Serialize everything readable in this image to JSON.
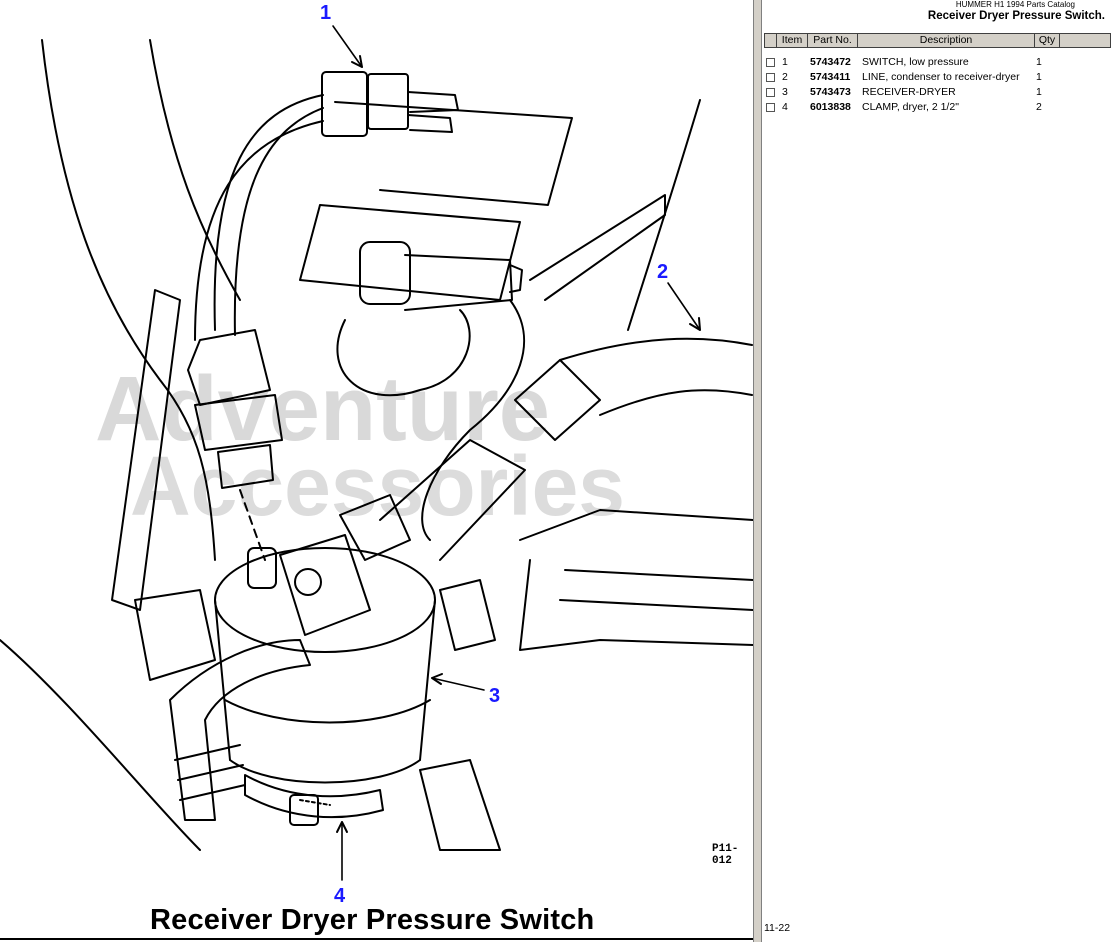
{
  "figure": {
    "callouts": [
      "1",
      "2",
      "3",
      "4"
    ],
    "code": "P11-012",
    "caption": "Receiver Dryer Pressure Switch",
    "watermark_line1": "Adventure",
    "watermark_line2": "Accessories"
  },
  "parts_panel": {
    "catalog_title": "HUMMER H1 1994 Parts Catalog",
    "heading": "Receiver Dryer Pressure Switch.",
    "columns": [
      "Item",
      "Part No.",
      "Description",
      "Qty"
    ],
    "rows": [
      {
        "item": "1",
        "part_no": "5743472",
        "description": "SWITCH, low pressure",
        "qty": "1"
      },
      {
        "item": "2",
        "part_no": "5743411",
        "description": "LINE, condenser to receiver-dryer",
        "qty": "1"
      },
      {
        "item": "3",
        "part_no": "5743473",
        "description": "RECEIVER-DRYER",
        "qty": "1"
      },
      {
        "item": "4",
        "part_no": "6013838",
        "description": "CLAMP, dryer, 2 1/2\"",
        "qty": "2"
      }
    ],
    "page_number": "11-22"
  },
  "colors": {
    "callout": "#1a1aff",
    "header_bg": "#d4d0c8",
    "watermark": "#d9d9d9",
    "seal": "#c9e3c0"
  }
}
